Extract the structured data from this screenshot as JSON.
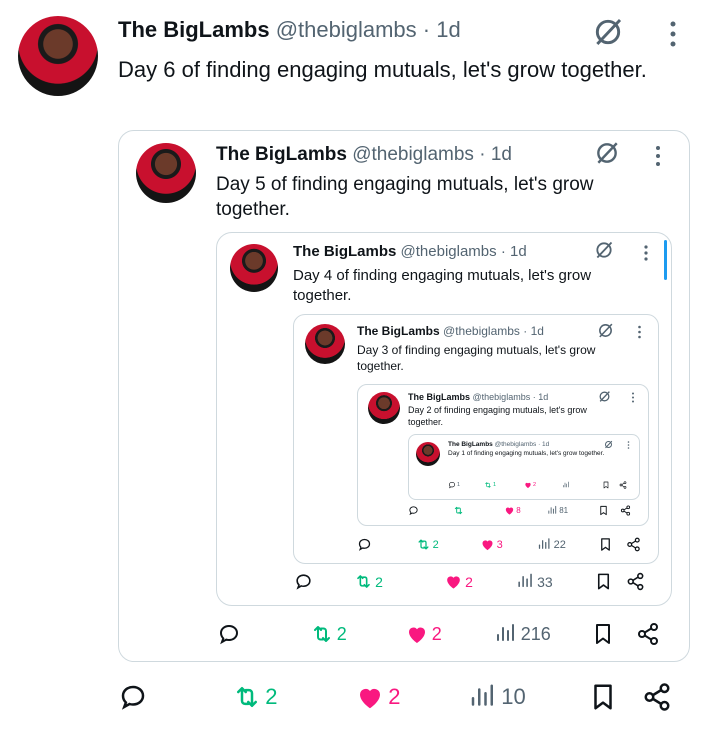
{
  "colors": {
    "retweet": "#00ba7c",
    "like": "#f91880",
    "muted": "#536471",
    "border": "#cfd9de"
  },
  "tweets": [
    {
      "name": "The BigLambs",
      "handle": "@thebiglambs",
      "time": "· 1d",
      "text": "Day 6 of finding engaging mutuals, let's grow together.",
      "retweets": "2",
      "likes": "2",
      "views": "10",
      "replies": ""
    },
    {
      "name": "The BigLambs",
      "handle": "@thebiglambs",
      "time": "· 1d",
      "text": "Day 5 of finding engaging mutuals, let's grow together.",
      "retweets": "2",
      "likes": "2",
      "views": "216",
      "replies": ""
    },
    {
      "name": "The BigLambs",
      "handle": "@thebiglambs",
      "time": "· 1d",
      "text": "Day 4 of finding engaging mutuals, let's grow together.",
      "retweets": "2",
      "likes": "2",
      "views": "33",
      "replies": ""
    },
    {
      "name": "The BigLambs",
      "handle": "@thebiglambs",
      "time": "· 1d",
      "text": "Day 3 of finding engaging mutuals, let's grow together.",
      "retweets": "2",
      "likes": "3",
      "views": "22",
      "replies": ""
    },
    {
      "name": "The BigLambs",
      "handle": "@thebiglambs",
      "time": "· 1d",
      "text": "Day 2 of finding engaging mutuals, let's grow together.",
      "retweets": "",
      "likes": "8",
      "views": "81",
      "replies": ""
    },
    {
      "name": "The BigLambs",
      "handle": "@thebiglambs",
      "time": "· 1d",
      "text": "Day 1 of finding engaging mutuals, let's grow together.",
      "retweets": "1",
      "likes": "2",
      "views": "",
      "replies": "1"
    }
  ]
}
